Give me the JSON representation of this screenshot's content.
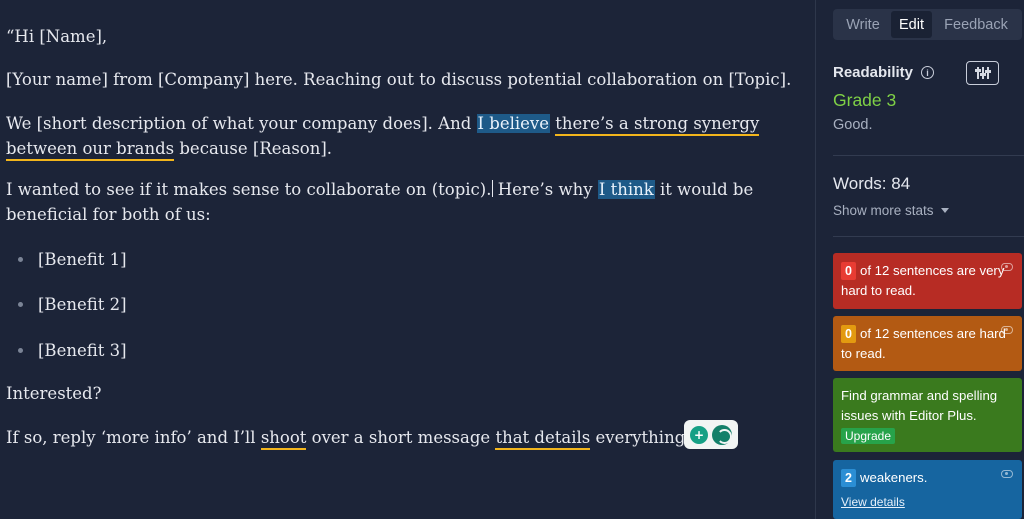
{
  "editor": {
    "greeting": "“Hi [Name],",
    "intro": "[Your name] from [Company] here. Reaching out to discuss potential collaboration on [Topic].",
    "p3": {
      "before": "We [short description of what your company does]. And ",
      "highlight": "I believe",
      "space": " ",
      "underline1": "there’s a strong synergy",
      "underline2": "between our brands",
      "after": " because [Reason]."
    },
    "p4": {
      "before": "I wanted to see if it makes sense to collaborate on (topic).",
      "mid": " Here’s why ",
      "highlight": "I think",
      "after": " it would be",
      "line2": "beneficial for both of us:"
    },
    "bullets": [
      "[Benefit 1]",
      "[Benefit 2]",
      "[Benefit 3]"
    ],
    "interested": "Interested?",
    "closing": {
      "before": "If so, reply ‘more info’ and I’ll ",
      "u1": "shoot",
      "mid": " over a short message ",
      "u2": "that details",
      "after": " everything.”"
    }
  },
  "sidebar": {
    "tabs": [
      "Write",
      "Edit",
      "Feedback"
    ],
    "active_tab": "Edit",
    "readability_label": "Readability",
    "grade": "Grade 3",
    "grade_desc": "Good.",
    "words": "Words: 84",
    "more_stats": "Show more stats",
    "cards": {
      "very_hard": {
        "count": "0",
        "text": "of 12 sentences are very hard to read."
      },
      "hard": {
        "count": "0",
        "text": "of 12 sentences are hard to read."
      },
      "grammar": {
        "text": "Find grammar and spelling issues with Editor Plus.",
        "button": "Upgrade"
      },
      "weakeners": {
        "count": "2",
        "text": "weakeners.",
        "link": "View details"
      }
    }
  },
  "colors": {
    "background": "#1c2438",
    "highlight_blue": "#1e5a88",
    "underline_yellow": "#f2b51c",
    "grade_green": "#7fd146",
    "card_red": "#b72c24",
    "card_orange": "#b35a13",
    "card_green": "#3a7a1e",
    "card_blue": "#1665a0"
  },
  "icons": [
    "info-icon",
    "settings-sliders-icon",
    "chevron-down-icon",
    "eye-icon",
    "lightbulb-icon",
    "grammarly-icon"
  ]
}
